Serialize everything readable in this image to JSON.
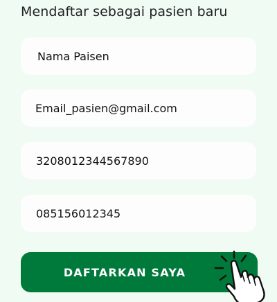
{
  "form": {
    "title": "Mendaftar sebagai pasien baru",
    "name_value": "Nama Paisen",
    "email_value": "Email_pasien@gmail.com",
    "nik_value": "3208012344567890",
    "phone_value": "085156012345"
  },
  "submit": {
    "label": "DAFTARKAN SAYA"
  },
  "icons": {
    "pointer": "tap-hand-icon"
  },
  "colors": {
    "background": "#f0fbf4",
    "field": "#fcfdfc",
    "button": "#007a3a"
  }
}
